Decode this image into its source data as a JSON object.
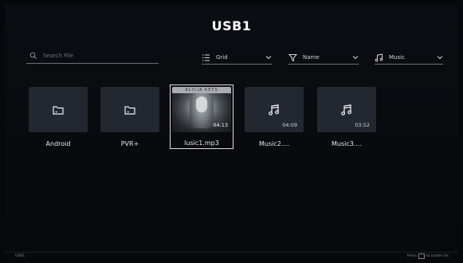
{
  "header": {
    "title": "USB1"
  },
  "search": {
    "placeholder": "Search File"
  },
  "controls": {
    "view": "Grid",
    "sort": "Name",
    "filter": "Music"
  },
  "items": [
    {
      "label": "Android",
      "type": "folder",
      "duration": ""
    },
    {
      "label": "PVR+",
      "type": "folder",
      "duration": ""
    },
    {
      "label": "lusic1.mp3",
      "type": "music-album",
      "duration": "04:13",
      "art_text": "ALICIA KEYS"
    },
    {
      "label": "Music2....",
      "type": "music",
      "duration": "04:09"
    },
    {
      "label": "Music3....",
      "type": "music",
      "duration": "03:52"
    }
  ],
  "footer": {
    "location": "USB1",
    "hint_before": "Press",
    "hint_after": "to create list"
  },
  "colors": {
    "background": "#090a0e",
    "tile": "#23272f",
    "accent": "#ffffff"
  }
}
